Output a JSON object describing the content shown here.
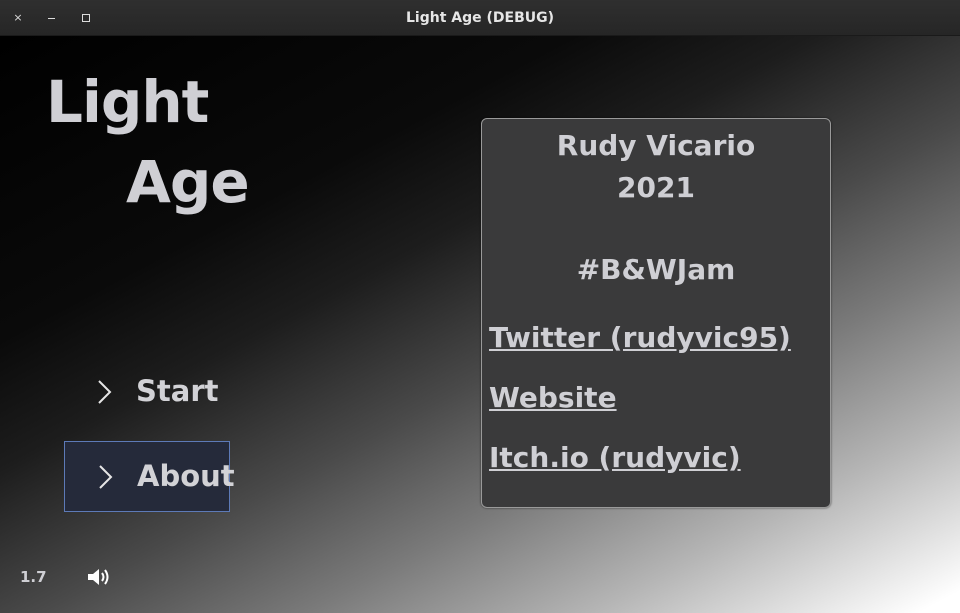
{
  "window": {
    "title": "Light Age (DEBUG)",
    "controls": {
      "close": "×"
    }
  },
  "logo": {
    "line1": "Light",
    "line2": "Age"
  },
  "menu": {
    "items": [
      {
        "label": "Start",
        "selected": false
      },
      {
        "label": "About",
        "selected": true
      }
    ]
  },
  "about": {
    "author": "Rudy Vicario",
    "year": "2021",
    "jam": "#B&WJam",
    "links": {
      "twitter": "Twitter (rudyvic95)",
      "website": "Website",
      "itch": "Itch.io (rudyvic)"
    }
  },
  "footer": {
    "version": "1.7",
    "sound_icon": "speaker-icon"
  },
  "colors": {
    "text": "#cfcfd4",
    "panel_bg": "#3a3a3b",
    "selection_bg": "#252a3a",
    "selection_border": "#5d7ab7"
  }
}
